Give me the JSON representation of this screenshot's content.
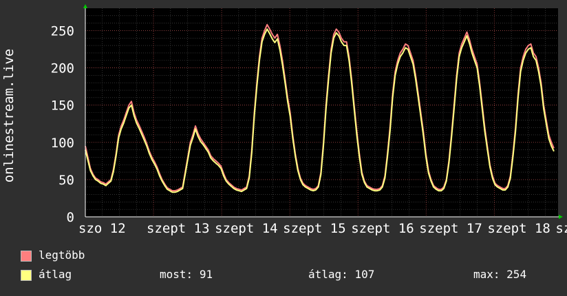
{
  "chart_data": {
    "type": "line",
    "ylabel": "onlinestream.live",
    "ylim": [
      0,
      280
    ],
    "yticks": [
      0,
      50,
      100,
      150,
      200,
      250
    ],
    "xlim": [
      0,
      165
    ],
    "x_tick_labels": [
      "szo 12",
      "szept 13",
      "szept 14",
      "szept 15",
      "szept 16",
      "szept 17",
      "szept 18",
      "szept"
    ],
    "x_tick_positions": [
      0,
      24,
      48,
      72,
      96,
      120,
      144,
      168
    ],
    "grid": true,
    "series": [
      {
        "name": "legtöbb",
        "color": "#ff7f7f",
        "values": [
          95,
          80,
          65,
          57,
          52,
          50,
          47,
          46,
          44,
          47,
          50,
          64,
          85,
          110,
          122,
          130,
          140,
          150,
          155,
          140,
          130,
          123,
          115,
          107,
          98,
          88,
          80,
          74,
          67,
          58,
          50,
          44,
          39,
          37,
          35,
          35,
          36,
          38,
          40,
          60,
          80,
          100,
          110,
          122,
          112,
          105,
          100,
          95,
          90,
          82,
          78,
          75,
          72,
          68,
          58,
          50,
          46,
          43,
          40,
          38,
          37,
          36,
          38,
          40,
          55,
          90,
          140,
          180,
          215,
          240,
          250,
          258,
          252,
          245,
          240,
          245,
          230,
          210,
          185,
          160,
          140,
          110,
          85,
          65,
          52,
          45,
          42,
          40,
          38,
          37,
          38,
          42,
          60,
          100,
          150,
          190,
          225,
          245,
          252,
          248,
          240,
          235,
          235,
          215,
          185,
          150,
          115,
          85,
          60,
          48,
          42,
          40,
          38,
          37,
          37,
          38,
          42,
          55,
          85,
          120,
          165,
          195,
          210,
          220,
          225,
          232,
          230,
          220,
          210,
          190,
          165,
          140,
          115,
          85,
          62,
          50,
          42,
          39,
          37,
          37,
          40,
          50,
          75,
          110,
          150,
          190,
          220,
          232,
          240,
          248,
          238,
          225,
          215,
          205,
          180,
          150,
          120,
          95,
          70,
          55,
          45,
          42,
          40,
          38,
          38,
          42,
          55,
          85,
          120,
          165,
          200,
          215,
          225,
          230,
          232,
          220,
          215,
          200,
          180,
          150,
          130,
          110,
          100,
          92
        ],
        "note": ""
      },
      {
        "name": "átlag",
        "color": "#ffff80",
        "values": [
          90,
          76,
          62,
          55,
          50,
          48,
          45,
          44,
          42,
          45,
          48,
          61,
          82,
          106,
          118,
          126,
          136,
          146,
          150,
          136,
          126,
          119,
          111,
          103,
          95,
          85,
          77,
          71,
          64,
          55,
          48,
          42,
          37,
          35,
          33,
          33,
          34,
          36,
          38,
          57,
          77,
          96,
          106,
          118,
          108,
          101,
          97,
          92,
          87,
          79,
          75,
          72,
          69,
          65,
          55,
          48,
          44,
          41,
          38,
          36,
          35,
          34,
          36,
          38,
          52,
          86,
          136,
          175,
          210,
          235,
          245,
          252,
          246,
          239,
          234,
          239,
          224,
          204,
          180,
          155,
          135,
          106,
          82,
          62,
          50,
          43,
          40,
          38,
          36,
          35,
          36,
          40,
          57,
          96,
          145,
          185,
          220,
          240,
          247,
          243,
          235,
          230,
          230,
          210,
          180,
          145,
          110,
          81,
          57,
          46,
          40,
          38,
          36,
          35,
          35,
          36,
          40,
          52,
          81,
          115,
          160,
          190,
          205,
          215,
          220,
          227,
          225,
          215,
          205,
          185,
          160,
          135,
          110,
          81,
          59,
          48,
          40,
          37,
          35,
          35,
          38,
          48,
          72,
          106,
          145,
          185,
          215,
          227,
          235,
          243,
          233,
          220,
          210,
          200,
          175,
          145,
          115,
          91,
          67,
          52,
          43,
          40,
          38,
          36,
          36,
          40,
          52,
          81,
          115,
          160,
          195,
          210,
          220,
          225,
          227,
          215,
          210,
          195,
          175,
          145,
          125,
          105,
          95,
          88
        ],
        "note": ""
      }
    ],
    "legend": [
      {
        "label": "legtöbb",
        "color": "#ff7f7f"
      },
      {
        "label": "átlag",
        "color": "#ffff80"
      }
    ],
    "stats": {
      "most_label": "most:",
      "most_value": "91",
      "avg_label": "átlag:",
      "avg_value": "107",
      "max_label": "max:",
      "max_value": "254"
    }
  }
}
